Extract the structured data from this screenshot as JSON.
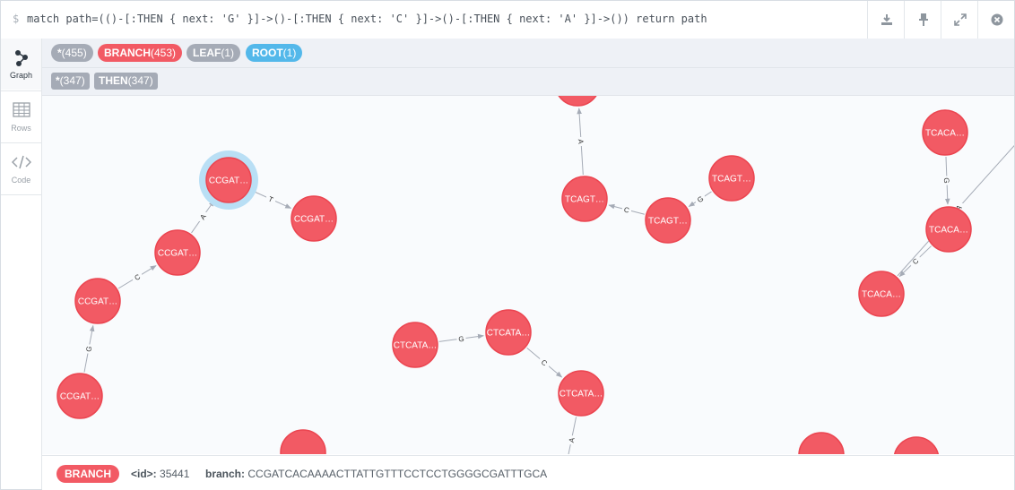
{
  "query": {
    "prompt": "$",
    "text": "match path=(()-[:THEN { next: 'G' }]->()-[:THEN { next: 'C' }]->()-[:THEN { next: 'A' }]->()) return path",
    "actions": [
      "download-icon",
      "pin-icon",
      "expand-icon",
      "close-icon"
    ]
  },
  "sidebar": {
    "items": [
      {
        "label": "Graph",
        "icon": "graph-icon",
        "active": true
      },
      {
        "label": "Rows",
        "icon": "table-icon",
        "active": false
      },
      {
        "label": "Code",
        "icon": "code-icon",
        "active": false
      }
    ]
  },
  "labels": [
    {
      "name": "*",
      "count": "(455)",
      "color": "#a5abb6"
    },
    {
      "name": "BRANCH",
      "count": "(453)",
      "color": "#f25a64"
    },
    {
      "name": "LEAF",
      "count": "(1)",
      "color": "#a5abb6"
    },
    {
      "name": "ROOT",
      "count": "(1)",
      "color": "#53b8ea"
    }
  ],
  "relationships": [
    {
      "name": "*",
      "count": "(347)"
    },
    {
      "name": "THEN",
      "count": "(347)"
    }
  ],
  "graph": {
    "node_color": "#f25a64",
    "selected_ring": "#b9dff5",
    "nodes": [
      {
        "id": "n1",
        "label": "CCGAT…",
        "selected": true
      },
      {
        "id": "n2",
        "label": "CCGAT…"
      },
      {
        "id": "n3",
        "label": "CCGAT…"
      },
      {
        "id": "n4",
        "label": "CCGAT…"
      },
      {
        "id": "n5",
        "label": "CCGAT…"
      },
      {
        "id": "n6",
        "label": "TCAGT…"
      },
      {
        "id": "n7",
        "label": "TCAGT…"
      },
      {
        "id": "n8",
        "label": "TCAGT…"
      },
      {
        "id": "n9",
        "label": ""
      },
      {
        "id": "n10",
        "label": "TCACA…"
      },
      {
        "id": "n11",
        "label": "TCACA…"
      },
      {
        "id": "n12",
        "label": "TCACA…"
      },
      {
        "id": "n13",
        "label": "CTCATA…"
      },
      {
        "id": "n14",
        "label": "CTCATA…"
      },
      {
        "id": "n15",
        "label": "CTCATA…"
      },
      {
        "id": "n16",
        "label": ""
      },
      {
        "id": "n17",
        "label": ""
      },
      {
        "id": "n18",
        "label": ""
      }
    ],
    "edges": [
      {
        "from": "n5",
        "to": "n4",
        "label": "G"
      },
      {
        "from": "n4",
        "to": "n3",
        "label": "C"
      },
      {
        "from": "n3",
        "to": "n1",
        "label": "A"
      },
      {
        "from": "n1",
        "to": "n2",
        "label": "T"
      },
      {
        "from": "n6",
        "to": "n7",
        "label": "G"
      },
      {
        "from": "n7",
        "to": "n8",
        "label": "C"
      },
      {
        "from": "n8",
        "to": "n9",
        "label": "A"
      },
      {
        "from": "n10",
        "to": "n11",
        "label": "G"
      },
      {
        "from": "n11",
        "to": "n12",
        "label": "C"
      },
      {
        "from": "n12",
        "to": "offscreen",
        "label": "A"
      },
      {
        "from": "n13",
        "to": "n14",
        "label": "G"
      },
      {
        "from": "n14",
        "to": "n15",
        "label": "C"
      },
      {
        "from": "n15",
        "to": "offscreen2",
        "label": "A"
      }
    ]
  },
  "inspector": {
    "label": "BRANCH",
    "id_key": "<id>:",
    "id_value": "35441",
    "branch_key": "branch:",
    "branch_value": "CCGATCACAAAACTTATTGTTTCCTCCTGGGGCGATTTGCA"
  }
}
